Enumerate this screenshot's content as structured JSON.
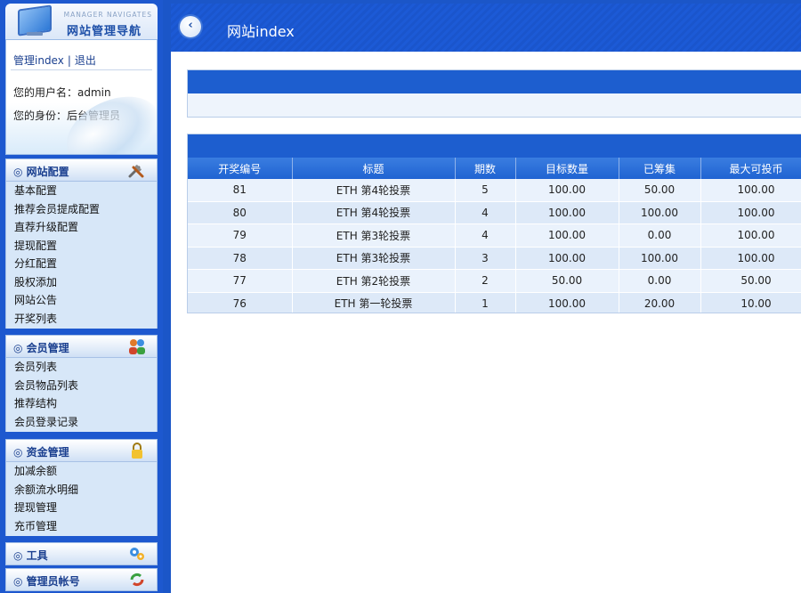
{
  "logo": {
    "subtitle": "MANAGER NAVIGATES",
    "title": "网站管理导航"
  },
  "user_panel": {
    "home_link": "管理index",
    "separator": "|",
    "logout_link": "退出",
    "username_line": "您的用户名：admin",
    "role_line": "您的身份：后台管理员"
  },
  "menus": {
    "site": {
      "header": "◎ 网站配置",
      "icon": "tools-icon",
      "items": [
        "基本配置",
        "推荐会员提成配置",
        "直荐升级配置",
        "提现配置",
        "分红配置",
        "股权添加",
        "网站公告",
        "开奖列表"
      ]
    },
    "members": {
      "header": "◎ 会员管理",
      "icon": "users-icon",
      "items": [
        "会员列表",
        "会员物品列表",
        "推荐结构",
        "会员登录记录"
      ]
    },
    "finance": {
      "header": "◎ 资金管理",
      "icon": "lock-icon",
      "items": [
        "加减余额",
        "余额流水明细",
        "提现管理",
        "充币管理"
      ]
    },
    "tools": {
      "header": "◎ 工具",
      "icon": "gears-icon"
    },
    "admin": {
      "header": "◎ 管理员帐号",
      "icon": "refresh-icon"
    }
  },
  "topbar": {
    "title": "网站index",
    "back_icon": "back-arrow-icon"
  },
  "table": {
    "columns": [
      "开奖编号",
      "标题",
      "期数",
      "目标数量",
      "已筹集",
      "最大可投币"
    ],
    "rows": [
      [
        "81",
        "ETH 第4轮投票",
        "5",
        "100.00",
        "50.00",
        "100.00"
      ],
      [
        "80",
        "ETH 第4轮投票",
        "4",
        "100.00",
        "100.00",
        "100.00"
      ],
      [
        "79",
        "ETH 第3轮投票",
        "4",
        "100.00",
        "0.00",
        "100.00"
      ],
      [
        "78",
        "ETH 第3轮投票",
        "3",
        "100.00",
        "100.00",
        "100.00"
      ],
      [
        "77",
        "ETH 第2轮投票",
        "2",
        "50.00",
        "0.00",
        "50.00"
      ],
      [
        "76",
        "ETH 第一轮投票",
        "1",
        "100.00",
        "20.00",
        "10.00"
      ]
    ]
  },
  "colors": {
    "sidebar_bg": "#1d58cf",
    "header_blue": "#1d5ecf",
    "row_light": "#eaf2fc",
    "row_dark": "#dde9f8"
  }
}
